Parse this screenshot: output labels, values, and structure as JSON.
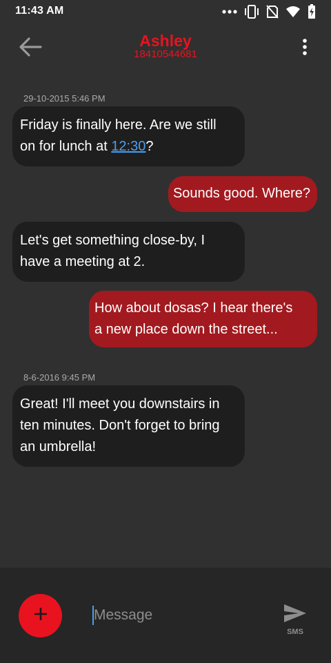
{
  "status_bar": {
    "time": "11:43 AM",
    "icons": [
      "more-dots-icon",
      "vibrate-icon",
      "no-sim-icon",
      "wifi-icon",
      "battery-icon"
    ]
  },
  "header": {
    "contact_name": "Ashley",
    "contact_number": "18410544681",
    "back_icon": "arrow-left-icon",
    "menu_icon": "overflow-menu-icon"
  },
  "messages": [
    {
      "type": "timestamp",
      "text": "29-10-2015 5:46 PM"
    },
    {
      "type": "incoming",
      "line1": "Friday is finally here. Are we still",
      "line2_prefix": "on for lunch at ",
      "line2_link": "12:30",
      "line2_suffix": "?"
    },
    {
      "type": "outgoing",
      "text": "Sounds good. Where?"
    },
    {
      "type": "incoming",
      "line1": "Let's get something close-by, I",
      "line2": "have a meeting at 2."
    },
    {
      "type": "outgoing",
      "line1": "How about dosas? I hear there's",
      "line2": "a new place down the street..."
    },
    {
      "type": "timestamp",
      "text": "8-6-2016 9:45 PM"
    },
    {
      "type": "incoming",
      "line1": "Great! I'll meet you downstairs in",
      "line2": "ten minutes. Don't forget to bring",
      "line3": "an umbrella!"
    }
  ],
  "composer": {
    "attach_icon": "plus-icon",
    "placeholder": "Message",
    "value": "",
    "send_icon": "send-icon",
    "send_label": "SMS"
  },
  "colors": {
    "accent": "#e8131f",
    "background": "#303030",
    "incoming_bubble": "#1e1e1e",
    "outgoing_bubble": "#a21a1f",
    "link": "#4a9ff0"
  }
}
